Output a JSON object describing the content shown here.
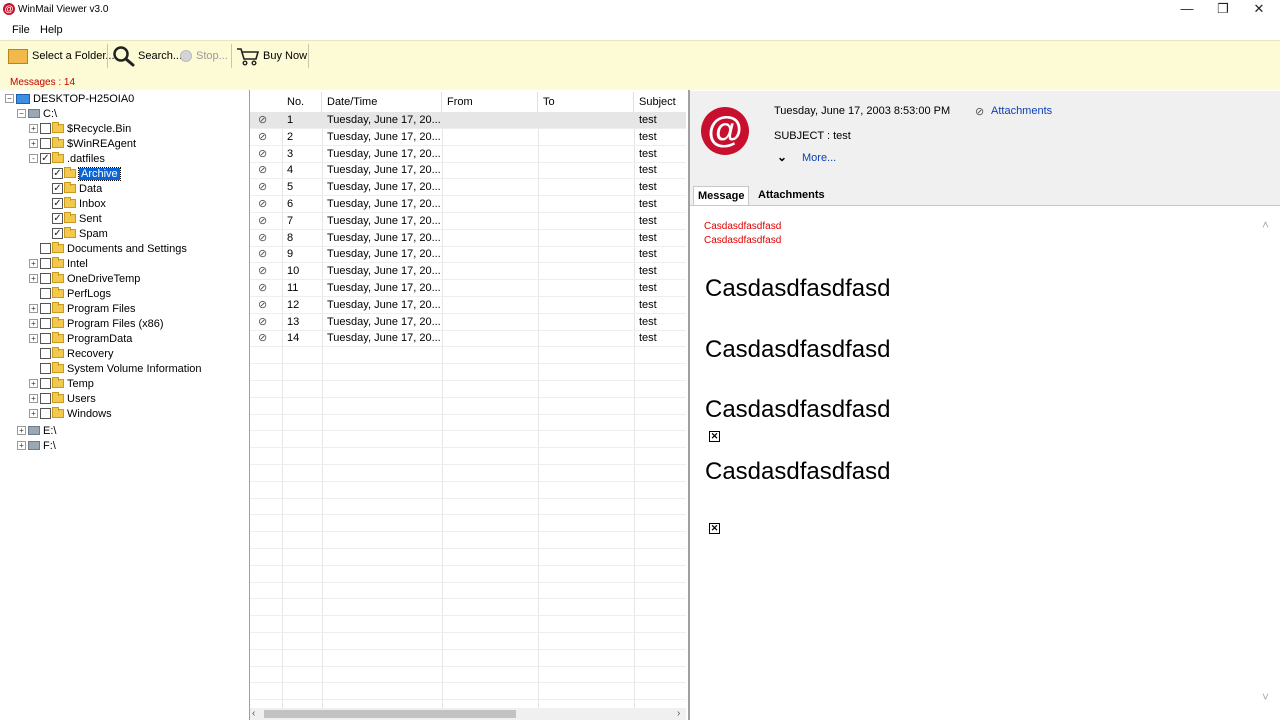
{
  "window": {
    "title": "WinMail Viewer v3.0",
    "minimize": "—",
    "maximize": "❐",
    "close": "✕"
  },
  "menu": [
    "File",
    "Help"
  ],
  "toolbar": {
    "select_folder": "Select a Folder...",
    "search": "Search...",
    "stop": "Stop...",
    "buy_now": "Buy Now"
  },
  "status": {
    "messages": "Messages : 14"
  },
  "tree": {
    "root": "DESKTOP-H25OIA0",
    "drive_c": "C:\\",
    "c_items": [
      {
        "label": "$Recycle.Bin",
        "expander": "+"
      },
      {
        "label": "$WinREAgent",
        "expander": "+"
      },
      {
        "label": ".datfiles",
        "expander": "-",
        "checked": true
      }
    ],
    "datfiles_items": [
      {
        "label": "Archive",
        "selected": true
      },
      {
        "label": "Data"
      },
      {
        "label": "Inbox"
      },
      {
        "label": "Sent"
      },
      {
        "label": "Spam"
      }
    ],
    "c_items_after": [
      {
        "label": "Documents and Settings",
        "expander": ""
      },
      {
        "label": "Intel",
        "expander": "+"
      },
      {
        "label": "OneDriveTemp",
        "expander": "+"
      },
      {
        "label": "PerfLogs",
        "expander": ""
      },
      {
        "label": "Program Files",
        "expander": "+"
      },
      {
        "label": "Program Files (x86)",
        "expander": "+"
      },
      {
        "label": "ProgramData",
        "expander": "+"
      },
      {
        "label": "Recovery",
        "expander": ""
      },
      {
        "label": "System Volume Information",
        "expander": ""
      },
      {
        "label": "Temp",
        "expander": "+"
      },
      {
        "label": "Users",
        "expander": "+"
      },
      {
        "label": "Windows",
        "expander": "+"
      }
    ],
    "drive_e": "E:\\",
    "drive_f": "F:\\"
  },
  "list": {
    "headers": [
      "No.",
      "Date/Time",
      "From",
      "To",
      "Subject"
    ],
    "rows": [
      {
        "no": "1",
        "date": "Tuesday, June 17, 20...",
        "subject": "test"
      },
      {
        "no": "2",
        "date": "Tuesday, June 17, 20...",
        "subject": "test"
      },
      {
        "no": "3",
        "date": "Tuesday, June 17, 20...",
        "subject": "test"
      },
      {
        "no": "4",
        "date": "Tuesday, June 17, 20...",
        "subject": "test"
      },
      {
        "no": "5",
        "date": "Tuesday, June 17, 20...",
        "subject": "test"
      },
      {
        "no": "6",
        "date": "Tuesday, June 17, 20...",
        "subject": "test"
      },
      {
        "no": "7",
        "date": "Tuesday, June 17, 20...",
        "subject": "test"
      },
      {
        "no": "8",
        "date": "Tuesday, June 17, 20...",
        "subject": "test"
      },
      {
        "no": "9",
        "date": "Tuesday, June 17, 20...",
        "subject": "test"
      },
      {
        "no": "10",
        "date": "Tuesday, June 17, 20...",
        "subject": "test"
      },
      {
        "no": "11",
        "date": "Tuesday, June 17, 20...",
        "subject": "test"
      },
      {
        "no": "12",
        "date": "Tuesday, June 17, 20...",
        "subject": "test"
      },
      {
        "no": "13",
        "date": "Tuesday, June 17, 20...",
        "subject": "test"
      },
      {
        "no": "14",
        "date": "Tuesday, June 17, 20...",
        "subject": "test"
      }
    ]
  },
  "preview": {
    "avatar": "@",
    "datetime": "Tuesday, June 17, 2003 8:53:00 PM",
    "attachments_link": "Attachments",
    "subject": "SUBJECT : test",
    "more": "More...",
    "tabs": [
      "Message",
      "Attachments"
    ],
    "red_lines": [
      "Casdasdfasdfasd",
      "Casdasdfasdfasd"
    ],
    "big_lines": [
      "Casdasdfasdfasd",
      "Casdasdfasdfasd",
      "Casdasdfasdfasd",
      "Casdasdfasdfasd"
    ],
    "broken_image": "✕"
  },
  "colors": {
    "toolbar_bg": "#fdfbd6",
    "brand_red": "#c8102e",
    "link_blue": "#0b3fb8",
    "selection": "#0a64d6",
    "count_red": "#c00000"
  }
}
